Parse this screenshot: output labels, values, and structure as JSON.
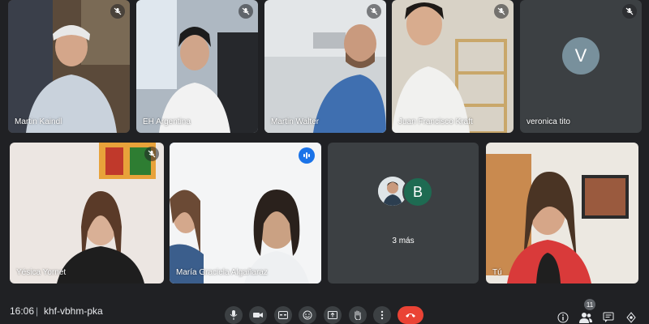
{
  "participants": [
    {
      "name": "Martin Kaindl",
      "muted": true
    },
    {
      "name": "EH Argentina",
      "muted": true
    },
    {
      "name": "Martin Walter",
      "muted": true
    },
    {
      "name": "Juan Francisco Kraft",
      "muted": true
    },
    {
      "name": "veronica tito",
      "muted": true,
      "initial": "V"
    },
    {
      "name": "Yésica Yornet",
      "muted": true
    },
    {
      "name": "María Graciela Algañaraz",
      "speaking": true
    },
    {
      "name": "Tú"
    }
  ],
  "overflow": {
    "initial": "B",
    "label": "3 más"
  },
  "meeting": {
    "time": "16:06",
    "separator": "|",
    "code": "khf-vbhm-pka"
  },
  "people_count": "11",
  "colors": {
    "background": "#202124",
    "tile": "#3c4043",
    "end_call": "#ea4335",
    "speaking": "#1a73e8",
    "avatar_v": "#78909c",
    "avatar_b": "#1e6b52"
  },
  "controls": [
    "mic-icon",
    "camera-icon",
    "captions-icon",
    "emoji-icon",
    "present-icon",
    "raise-hand-icon",
    "more-options-icon",
    "end-call-icon"
  ],
  "right_icons": [
    "info-icon",
    "people-icon",
    "chat-icon",
    "activities-icon"
  ]
}
